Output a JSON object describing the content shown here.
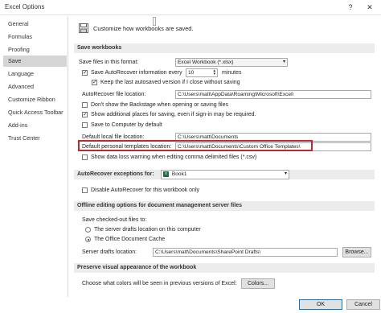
{
  "window": {
    "title": "Excel Options",
    "help": "?",
    "close": "✕"
  },
  "sidebar": {
    "items": [
      {
        "label": "General"
      },
      {
        "label": "Formulas"
      },
      {
        "label": "Proofing"
      },
      {
        "label": "Save"
      },
      {
        "label": "Language"
      },
      {
        "label": "Advanced"
      },
      {
        "label": "Customize Ribbon"
      },
      {
        "label": "Quick Access Toolbar"
      },
      {
        "label": "Add-ins"
      },
      {
        "label": "Trust Center"
      }
    ],
    "selected": "Save"
  },
  "header": {
    "text": "Customize how workbooks are saved."
  },
  "save_workbooks": {
    "title": "Save workbooks",
    "format_label": "Save files in this format:",
    "format_value": "Excel Workbook (*.xlsx)",
    "autorecover_label": "Save AutoRecover information every",
    "autorecover_minutes": "10",
    "minutes_label": "minutes",
    "keep_last_label": "Keep the last autosaved version if I close without saving",
    "autorecover_location_label": "AutoRecover file location:",
    "autorecover_location_value": "C:\\Users\\matt\\AppData\\Roaming\\Microsoft\\Excel\\",
    "backstage_label": "Don't show the Backstage when opening or saving files",
    "additional_places_label": "Show additional places for saving, even if sign-in may be required.",
    "computer_default_label": "Save to Computer by default",
    "default_local_label": "Default local file location:",
    "default_local_value": "C:\\Users\\matt\\Documents",
    "personal_templates_label": "Default personal templates location:",
    "personal_templates_value": "C:\\Users\\matt\\Documents\\Custom Office Templates\\",
    "data_loss_label": "Show data loss warning when editing comma delimited files (*.csv)"
  },
  "autorecover_exceptions": {
    "title": "AutoRecover exceptions for:",
    "workbook": "Book1",
    "disable_label": "Disable AutoRecover for this workbook only"
  },
  "offline_editing": {
    "title": "Offline editing options for document management server files",
    "save_checked_out_label": "Save checked-out files to:",
    "server_drafts_option": "The server drafts location on this computer",
    "office_cache_option": "The Office Document Cache",
    "server_drafts_label": "Server drafts location:",
    "server_drafts_value": "C:\\Users\\matt\\Documents\\SharePoint Drafts\\",
    "browse_label": "Browse..."
  },
  "visual": {
    "title": "Preserve visual appearance of the workbook",
    "colors_label": "Choose what colors will be seen in previous versions of Excel:",
    "colors_button": "Colors..."
  },
  "footer": {
    "ok": "OK",
    "cancel": "Cancel"
  },
  "colors": {
    "highlight": "#c0282d",
    "selected_nav": "#d5d5d5",
    "section_bg": "#ececec",
    "excel_green": "#1d6f42"
  }
}
